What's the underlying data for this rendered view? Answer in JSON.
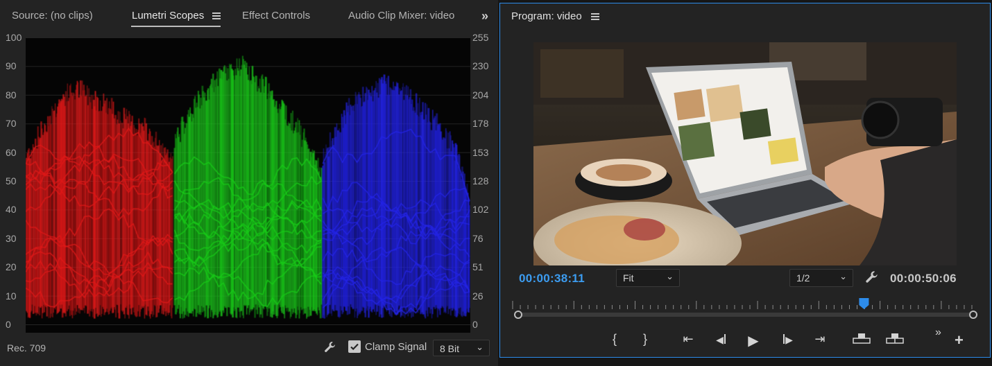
{
  "colors": {
    "accent": "#2d8ceb",
    "timecode": "#3c9cf0",
    "panel": "#232323",
    "red": "#e01818",
    "green": "#19cc19",
    "blue": "#2222e6"
  },
  "left_tabs": {
    "source": "Source: (no clips)",
    "lumetri": "Lumetri Scopes",
    "effect_controls": "Effect Controls",
    "audio_mixer": "Audio Clip Mixer: video",
    "overflow_icon": "double-chevron-right-icon",
    "menu_icon": "hamburger-menu-icon"
  },
  "scope": {
    "type": "RGB Parade",
    "left_ticks": [
      "100",
      "90",
      "80",
      "70",
      "60",
      "50",
      "40",
      "30",
      "20",
      "10",
      "0"
    ],
    "right_ticks": [
      "255",
      "230",
      "204",
      "178",
      "153",
      "128",
      "102",
      "76",
      "51",
      "26",
      "0"
    ]
  },
  "scope_footer": {
    "color_space": "Rec. 709",
    "clamp_label": "Clamp Signal",
    "clamp_checked": true,
    "bit_depth": "8 Bit",
    "settings_icon": "wrench-icon"
  },
  "program": {
    "title": "Program: video",
    "timecode_current": "00:00:38:11",
    "fit_value": "Fit",
    "resolution_value": "1/2",
    "timecode_duration": "00:00:50:06",
    "playhead_fraction": 0.765,
    "controls": [
      {
        "name": "mark-in-icon",
        "glyph": "{"
      },
      {
        "name": "mark-out-icon",
        "glyph": "}"
      },
      {
        "name": "go-to-in-icon",
        "glyph": "⇤"
      },
      {
        "name": "step-back-icon",
        "glyph": "◀"
      },
      {
        "name": "play-icon",
        "glyph": "▶"
      },
      {
        "name": "step-forward-icon",
        "glyph": "▶"
      },
      {
        "name": "go-to-out-icon",
        "glyph": "⇥"
      },
      {
        "name": "lift-icon",
        "glyph": "▣"
      },
      {
        "name": "extract-icon",
        "glyph": "▣"
      }
    ],
    "more_icon": "double-chevron-right-icon",
    "add_icon": "plus-icon"
  }
}
